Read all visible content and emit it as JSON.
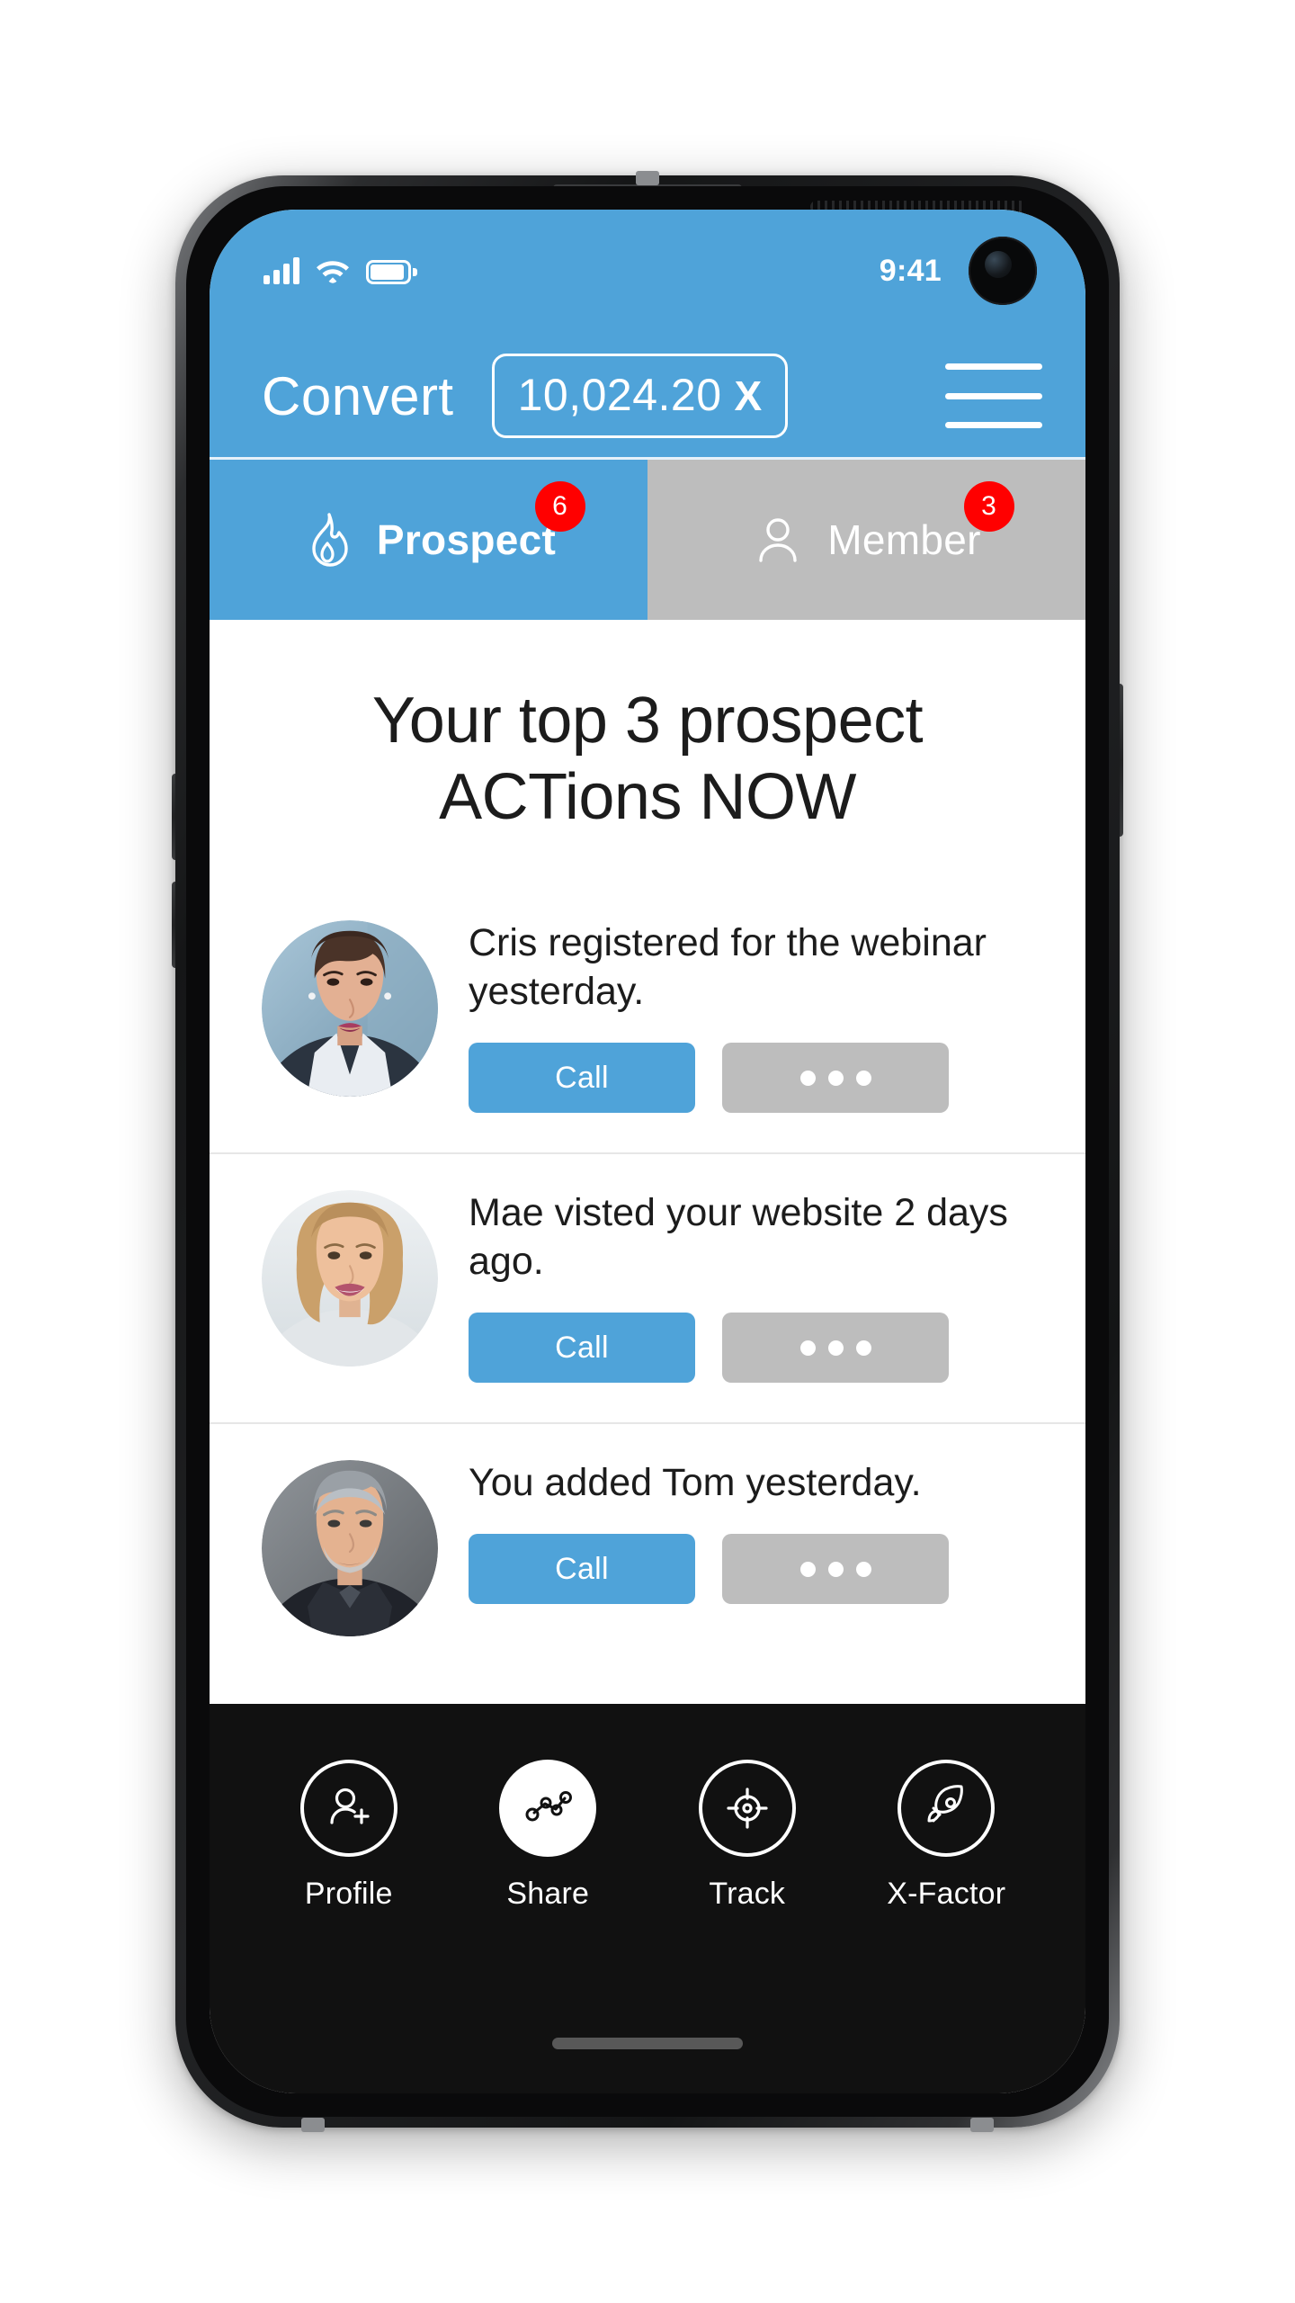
{
  "status_bar": {
    "time": "9:41",
    "icons": [
      "signal-bars-icon",
      "wifi-icon",
      "battery-icon"
    ],
    "camera": "front-camera-punch-hole"
  },
  "header": {
    "app_title": "Convert",
    "amount_value": "10,024.20",
    "amount_symbol": "X",
    "menu_icon": "hamburger-menu-icon",
    "background_color": "#4fa3d9"
  },
  "tabs": [
    {
      "label": "Prospect",
      "icon": "flame-icon",
      "badge": "6",
      "active": true,
      "bg": "#4fa3d9"
    },
    {
      "label": "Member",
      "icon": "person-icon",
      "badge": "3",
      "active": false,
      "bg": "#bdbdbd"
    }
  ],
  "main": {
    "headline": "Your top 3 prospect ACTions NOW",
    "headline_line1": "Your top 3 prospect",
    "headline_line2": "ACTions NOW",
    "rows": [
      {
        "text": "Cris registered for the webinar yesterday.",
        "avatar": "woman-dark-hair-avatar",
        "call_label": "Call",
        "more_label": "•••"
      },
      {
        "text": "Mae visted your website 2 days ago.",
        "avatar": "woman-blonde-avatar",
        "call_label": "Call",
        "more_label": "•••"
      },
      {
        "text": "You added Tom yesterday.",
        "avatar": "man-grey-hair-avatar",
        "call_label": "Call",
        "more_label": "•••"
      }
    ]
  },
  "bottom_nav": {
    "items": [
      {
        "label": "Profile",
        "icon": "add-person-icon",
        "highlight": false
      },
      {
        "label": "Share",
        "icon": "share-nodes-icon",
        "highlight": true
      },
      {
        "label": "Track",
        "icon": "target-icon",
        "highlight": false
      },
      {
        "label": "X-Factor",
        "icon": "rocket-icon",
        "highlight": false
      }
    ],
    "background_color": "#111111"
  },
  "colors": {
    "accent_blue": "#4fa3d9",
    "inactive_grey": "#bdbdbd",
    "badge_red": "#ff0000",
    "nav_black": "#111111"
  }
}
